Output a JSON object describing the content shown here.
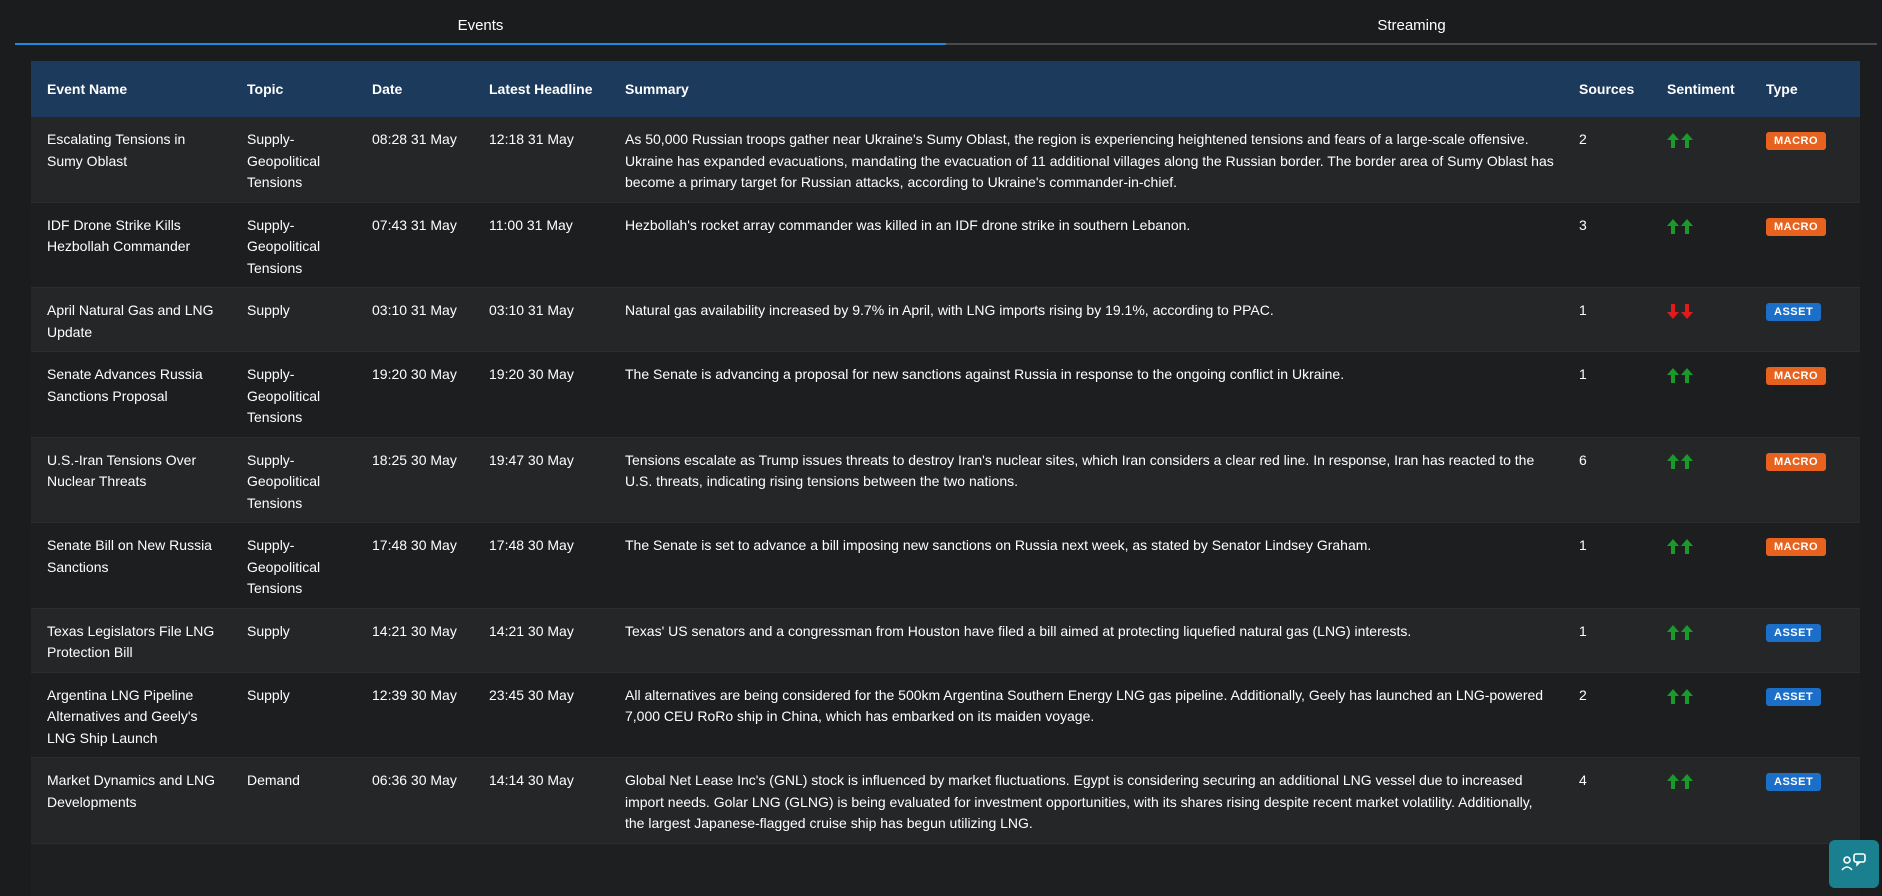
{
  "tabs": [
    {
      "label": "Events",
      "active": true
    },
    {
      "label": "Streaming",
      "active": false
    }
  ],
  "table": {
    "headers": [
      "Event Name",
      "Topic",
      "Date",
      "Latest Headline",
      "Summary",
      "Sources",
      "Sentiment",
      "Type"
    ],
    "rows": [
      {
        "event": "Escalating Tensions in Sumy Oblast",
        "topic": "Supply-Geopolitical Tensions",
        "date": "08:28 31 May",
        "headline": "12:18 31 May",
        "summary": "As 50,000 Russian troops gather near Ukraine's Sumy Oblast, the region is experiencing heightened tensions and fears of a large-scale offensive. Ukraine has expanded evacuations, mandating the evacuation of 11 additional villages along the Russian border. The border area of Sumy Oblast has become a primary target for Russian attacks, according to Ukraine's commander-in-chief.",
        "sources": "2",
        "sentiment": "up",
        "type": "MACRO"
      },
      {
        "event": "IDF Drone Strike Kills Hezbollah Commander",
        "topic": "Supply-Geopolitical Tensions",
        "date": "07:43 31 May",
        "headline": "11:00 31 May",
        "summary": "Hezbollah's rocket array commander was killed in an IDF drone strike in southern Lebanon.",
        "sources": "3",
        "sentiment": "up",
        "type": "MACRO"
      },
      {
        "event": "April Natural Gas and LNG Update",
        "topic": "Supply",
        "date": "03:10 31 May",
        "headline": "03:10 31 May",
        "summary": "Natural gas availability increased by 9.7% in April, with LNG imports rising by 19.1%, according to PPAC.",
        "sources": "1",
        "sentiment": "down",
        "type": "ASSET"
      },
      {
        "event": "Senate Advances Russia Sanctions Proposal",
        "topic": "Supply-Geopolitical Tensions",
        "date": "19:20 30 May",
        "headline": "19:20 30 May",
        "summary": "The Senate is advancing a proposal for new sanctions against Russia in response to the ongoing conflict in Ukraine.",
        "sources": "1",
        "sentiment": "up",
        "type": "MACRO"
      },
      {
        "event": "U.S.-Iran Tensions Over Nuclear Threats",
        "topic": "Supply-Geopolitical Tensions",
        "date": "18:25 30 May",
        "headline": "19:47 30 May",
        "summary": "Tensions escalate as Trump issues threats to destroy Iran's nuclear sites, which Iran considers a clear red line. In response, Iran has reacted to the U.S. threats, indicating rising tensions between the two nations.",
        "sources": "6",
        "sentiment": "up",
        "type": "MACRO"
      },
      {
        "event": "Senate Bill on New Russia Sanctions",
        "topic": "Supply-Geopolitical Tensions",
        "date": "17:48 30 May",
        "headline": "17:48 30 May",
        "summary": "The Senate is set to advance a bill imposing new sanctions on Russia next week, as stated by Senator Lindsey Graham.",
        "sources": "1",
        "sentiment": "up",
        "type": "MACRO"
      },
      {
        "event": "Texas Legislators File LNG Protection Bill",
        "topic": "Supply",
        "date": "14:21 30 May",
        "headline": "14:21 30 May",
        "summary": "Texas' US senators and a congressman from Houston have filed a bill aimed at protecting liquefied natural gas (LNG) interests.",
        "sources": "1",
        "sentiment": "up",
        "type": "ASSET"
      },
      {
        "event": "Argentina LNG Pipeline Alternatives and Geely's LNG Ship Launch",
        "topic": "Supply",
        "date": "12:39 30 May",
        "headline": "23:45 30 May",
        "summary": "All alternatives are being considered for the 500km Argentina Southern Energy LNG gas pipeline. Additionally, Geely has launched an LNG-powered 7,000 CEU RoRo ship in China, which has embarked on its maiden voyage.",
        "sources": "2",
        "sentiment": "up",
        "type": "ASSET"
      },
      {
        "event": "Market Dynamics and LNG Developments",
        "topic": "Demand",
        "date": "06:36 30 May",
        "headline": "14:14 30 May",
        "summary": "Global Net Lease Inc's (GNL) stock is influenced by market fluctuations. Egypt is considering securing an additional LNG vessel due to increased import needs. Golar LNG (GLNG) is being evaluated for investment opportunities, with its shares rising despite recent market volatility. Additionally, the largest Japanese-flagged cruise ship has begun utilizing LNG.",
        "sources": "4",
        "sentiment": "up",
        "type": "ASSET"
      }
    ]
  },
  "colors": {
    "sentiment_up": "#1a9a2a",
    "sentiment_down": "#e01b1b",
    "macro": "#e6621e",
    "asset": "#1b6fc9",
    "header_bg": "#1c3a5b",
    "tab_active": "#1e88e5"
  },
  "icons": {
    "fab": "chat-support-icon",
    "sentiment_up": "double-up-arrow-icon",
    "sentiment_down": "double-down-arrow-icon"
  }
}
